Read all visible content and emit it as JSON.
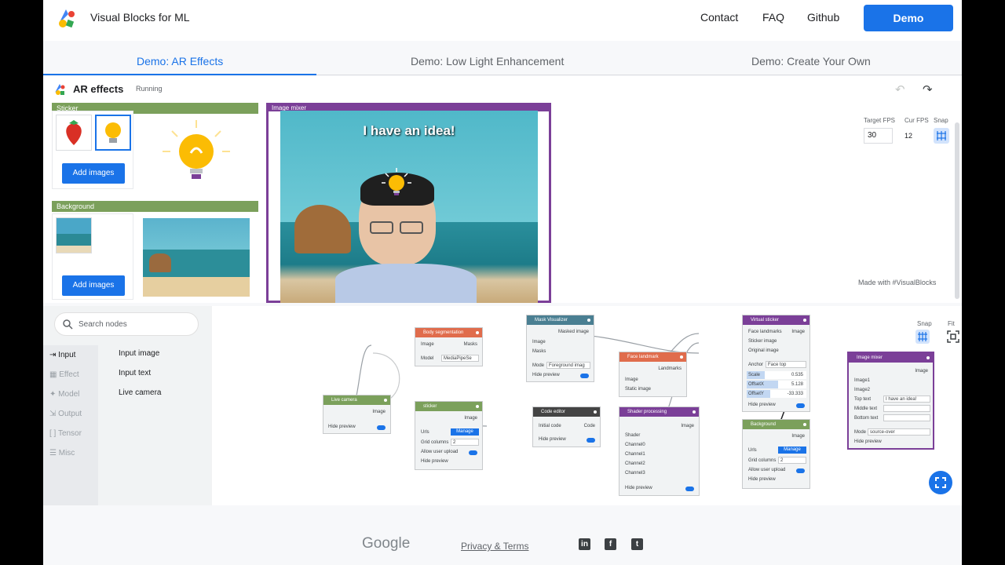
{
  "header": {
    "brand": "Visual Blocks for ML",
    "nav": [
      "Contact",
      "FAQ",
      "Github"
    ],
    "demo_button": "Demo"
  },
  "tabs": [
    {
      "label": "Demo: AR Effects",
      "active": true
    },
    {
      "label": "Demo: Low Light Enhancement",
      "active": false
    },
    {
      "label": "Demo: Create Your Own",
      "active": false
    }
  ],
  "toolbar": {
    "title": "AR effects",
    "status": "Running"
  },
  "preview": {
    "sticker_panel": {
      "title": "Sticker",
      "add_button": "Add images"
    },
    "background_panel": {
      "title": "Background",
      "add_button": "Add images"
    },
    "mixer": {
      "title": "Image mixer",
      "caption": "I have an idea!"
    },
    "fps": {
      "target_label": "Target FPS",
      "target_value": "30",
      "cur_label": "Cur FPS",
      "cur_value": "12",
      "snap_label": "Snap"
    },
    "made_with": "Made with #VisualBlocks"
  },
  "editor": {
    "search_placeholder": "Search nodes",
    "categories": [
      "Input",
      "Effect",
      "Model",
      "Output",
      "Tensor",
      "Misc"
    ],
    "items": [
      "Input image",
      "Input text",
      "Live camera"
    ],
    "snap": "Snap",
    "fit": "Fit",
    "nodes": {
      "live_camera": {
        "title": "Live camera",
        "out": "Image",
        "hide": "Hide preview"
      },
      "body_seg": {
        "title": "Body segmentation",
        "in": "Image",
        "out": "Masks",
        "model_label": "Model",
        "model_value": "MediaPipeSe"
      },
      "sticker": {
        "title": "sticker",
        "out": "Image",
        "urls": "Urls",
        "manage": "Manage",
        "grid": "Grid columns",
        "grid_value": "2",
        "allow": "Allow user upload",
        "hide": "Hide preview"
      },
      "mask_vis": {
        "title": "Mask Visualizer",
        "out": "Masked image",
        "in1": "Image",
        "in2": "Masks",
        "mode": "Mode",
        "mode_value": "Foreground imag",
        "hide": "Hide preview"
      },
      "face_landmark": {
        "title": "Face landmark",
        "out": "Landmarks",
        "in1": "Image",
        "in2": "Static image"
      },
      "code_editor": {
        "title": "Code editor",
        "in": "Initial code",
        "out": "Code",
        "hide": "Hide preview"
      },
      "shader": {
        "title": "Shader processing",
        "out": "Image",
        "in": [
          "Shader",
          "Channel0",
          "Channel1",
          "Channel2",
          "Channel3"
        ],
        "hide": "Hide preview"
      },
      "virtual_sticker": {
        "title": "Virtual sticker",
        "out": "Image",
        "in": [
          "Face landmarks",
          "Sticker image",
          "Original image"
        ],
        "anchor": "Anchor",
        "anchor_value": "Face top",
        "scale": "Scale",
        "scale_value": "0.535",
        "offx": "OffsetX",
        "offx_value": "5.128",
        "offy": "OffsetY",
        "offy_value": "-33.333",
        "hide": "Hide preview"
      },
      "background": {
        "title": "Background",
        "out": "Image",
        "urls": "Urls",
        "manage": "Manage",
        "grid": "Grid columns",
        "grid_value": "2",
        "allow": "Allow user upload",
        "hide": "Hide preview"
      },
      "image_mixer": {
        "title": "Image mixer",
        "out": "Image",
        "in": [
          "Image1",
          "Image2",
          "Top text",
          "Middle text",
          "Bottom text"
        ],
        "top_text_value": "I have an idea!",
        "mode": "Mode",
        "mode_value": "source-over",
        "hide": "Hide preview"
      }
    }
  },
  "footer": {
    "google": "Google",
    "privacy": "Privacy & Terms",
    "social": [
      "in",
      "f",
      "t"
    ]
  },
  "colors": {
    "accent": "#1a73e8",
    "green_node": "#7ba05b",
    "purple_node": "#7b3f98",
    "orange_node": "#e06c4c",
    "teal_node": "#4a7f92",
    "dark_node": "#444"
  }
}
